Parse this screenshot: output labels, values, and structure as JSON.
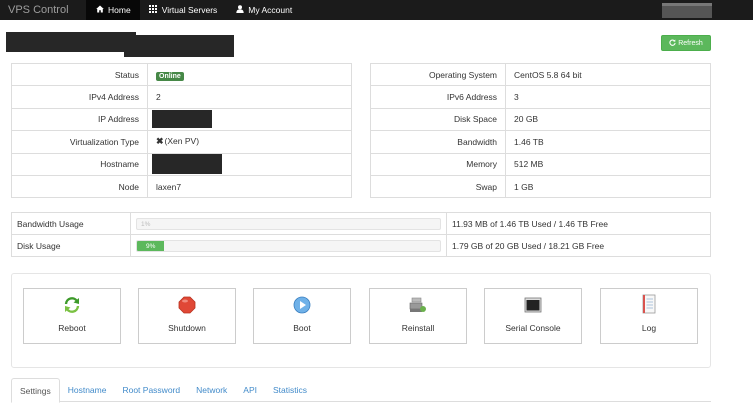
{
  "navbar": {
    "brand": "VPS Control",
    "items": [
      {
        "label": "Home",
        "icon": "home-icon",
        "active": true
      },
      {
        "label": "Virtual Servers",
        "icon": "grid-icon",
        "active": false
      },
      {
        "label": "My Account",
        "icon": "user-icon",
        "active": false
      }
    ]
  },
  "toolbar": {
    "refresh_label": "Refresh"
  },
  "server_info": {
    "status_label": "Status",
    "status_value": "Online",
    "ipv4_label": "IPv4 Address",
    "ipv4_value": "2",
    "ip_label": "IP Address",
    "virt_label": "Virtualization Type",
    "virt_value": "(Xen PV)",
    "hostname_label": "Hostname",
    "node_label": "Node",
    "node_value": "laxen7"
  },
  "system_info": {
    "os_label": "Operating System",
    "os_value": "CentOS 5.8 64 bit",
    "ipv6_label": "IPv6 Address",
    "ipv6_value": "3",
    "disk_label": "Disk Space",
    "disk_value": "20 GB",
    "bw_label": "Bandwidth",
    "bw_value": "1.46 TB",
    "mem_label": "Memory",
    "mem_value": "512 MB",
    "swap_label": "Swap",
    "swap_value": "1 GB"
  },
  "usage": {
    "bandwidth_label": "Bandwidth Usage",
    "bandwidth_percent_text": "1%",
    "bandwidth_percent": 0,
    "bandwidth_text": "11.93 MB of 1.46 TB Used / 1.46 TB Free",
    "disk_label": "Disk Usage",
    "disk_percent_text": "9%",
    "disk_percent": 9,
    "disk_text": "1.79 GB of 20 GB Used / 18.21 GB Free"
  },
  "actions": [
    {
      "label": "Reboot",
      "icon": "reboot-icon"
    },
    {
      "label": "Shutdown",
      "icon": "shutdown-icon"
    },
    {
      "label": "Boot",
      "icon": "boot-icon"
    },
    {
      "label": "Reinstall",
      "icon": "reinstall-icon"
    },
    {
      "label": "Serial Console",
      "icon": "serial-console-icon"
    },
    {
      "label": "Log",
      "icon": "log-icon"
    }
  ],
  "tabs": [
    {
      "label": "Settings",
      "active": true
    },
    {
      "label": "Hostname"
    },
    {
      "label": "Root Password"
    },
    {
      "label": "Network"
    },
    {
      "label": "API"
    },
    {
      "label": "Statistics"
    }
  ],
  "colors": {
    "navbar_bg": "#1b1b1b",
    "success": "#5cb85c",
    "online_badge": "#468847",
    "link": "#428bca"
  }
}
